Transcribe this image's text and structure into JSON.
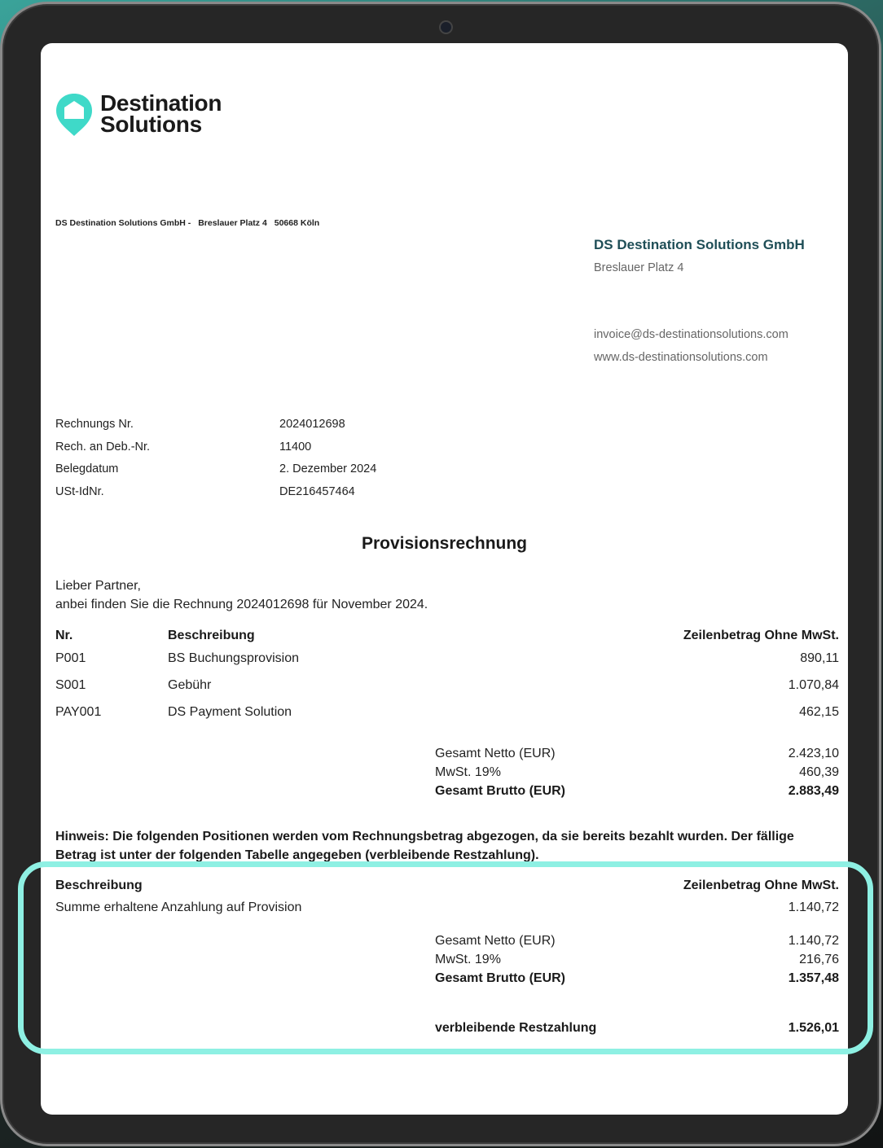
{
  "brand": {
    "line1": "Destination",
    "line2": "Solutions",
    "accent_color": "#3fd9c8"
  },
  "sender_line": [
    "DS Destination Solutions GmbH -",
    "Breslauer Platz 4",
    "50668 Köln"
  ],
  "company": {
    "name": "DS Destination Solutions GmbH",
    "address": "Breslauer Platz 4",
    "email": "invoice@ds-destinationsolutions.com",
    "web": "www.ds-destinationsolutions.com"
  },
  "meta": [
    {
      "label": "Rechnungs Nr.",
      "value": "2024012698"
    },
    {
      "label": "Rech. an Deb.-Nr.",
      "value": "11400"
    },
    {
      "label": "Belegdatum",
      "value": "2. Dezember 2024"
    },
    {
      "label": "USt-IdNr.",
      "value": "DE216457464"
    }
  ],
  "title": "Provisionsrechnung",
  "intro": [
    "Lieber Partner,",
    "anbei finden Sie die Rechnung 2024012698 für November 2024."
  ],
  "table1": {
    "headers": {
      "nr": "Nr.",
      "desc": "Beschreibung",
      "amount": "Zeilenbetrag Ohne MwSt."
    },
    "rows": [
      {
        "nr": "P001",
        "desc": "BS Buchungsprovision",
        "amount": "890,11"
      },
      {
        "nr": "S001",
        "desc": "Gebühr",
        "amount": "1.070,84"
      },
      {
        "nr": "PAY001",
        "desc": "DS Payment Solution",
        "amount": "462,15"
      }
    ],
    "totals": [
      {
        "label": "Gesamt Netto (EUR)",
        "value": "2.423,10"
      },
      {
        "label": "MwSt. 19%",
        "value": "460,39"
      },
      {
        "label": "Gesamt Brutto (EUR)",
        "value": "2.883,49"
      }
    ]
  },
  "note": "Hinweis: Die folgenden Positionen werden vom Rechnungsbetrag abgezogen, da sie bereits bezahlt wurden. Der fällige Betrag ist unter der folgenden Tabelle angegeben (verbleibende Restzahlung).",
  "table2": {
    "headers": {
      "desc": "Beschreibung",
      "amount": "Zeilenbetrag Ohne MwSt."
    },
    "rows": [
      {
        "desc": "Summe erhaltene Anzahlung auf Provision",
        "amount": "1.140,72"
      }
    ],
    "totals": [
      {
        "label": "Gesamt Netto (EUR)",
        "value": "1.140,72"
      },
      {
        "label": "MwSt. 19%",
        "value": "216,76"
      },
      {
        "label": "Gesamt Brutto (EUR)",
        "value": "1.357,48"
      }
    ],
    "remaining": {
      "label": "verbleibende Restzahlung",
      "value": "1.526,01"
    }
  },
  "highlight_color": "#8ef0e3"
}
